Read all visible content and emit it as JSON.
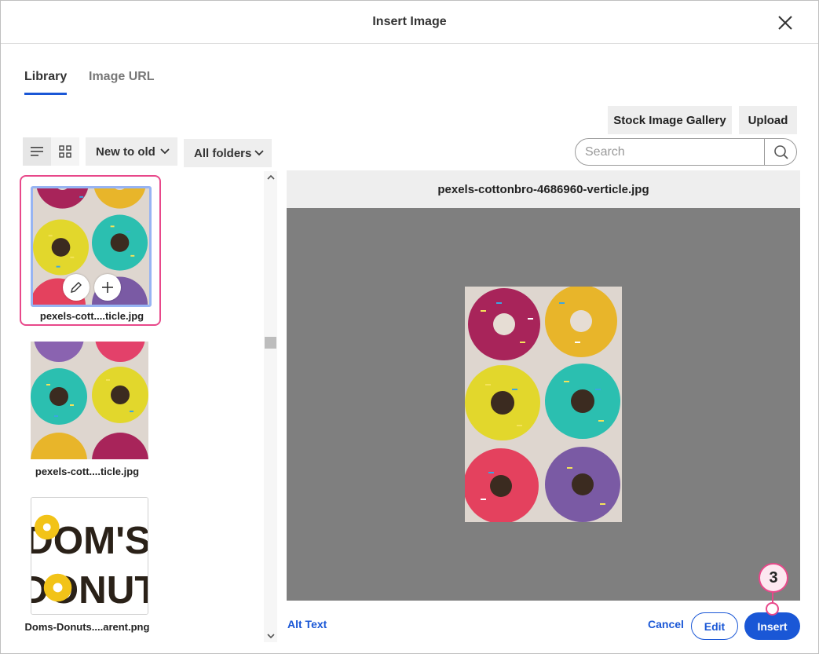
{
  "dialog": {
    "title": "Insert Image"
  },
  "tabs": [
    {
      "label": "Library",
      "active": true
    },
    {
      "label": "Image URL",
      "active": false
    }
  ],
  "actions": {
    "stock_gallery": "Stock Image Gallery",
    "upload": "Upload"
  },
  "toolbar": {
    "view_mode": "list",
    "sort": "New to old",
    "folder": "All folders",
    "search_placeholder": "Search"
  },
  "library": {
    "items": [
      {
        "filename": "pexels-cott....ticle.jpg",
        "selected": true
      },
      {
        "filename": "pexels-cott....ticle.jpg",
        "selected": false
      },
      {
        "filename": "Doms-Donuts....arent.png",
        "selected": false
      }
    ]
  },
  "preview": {
    "filename": "pexels-cottonbro-4686960-verticle.jpg"
  },
  "footer": {
    "alt_text": "Alt Text",
    "cancel": "Cancel",
    "edit": "Edit",
    "insert": "Insert"
  },
  "annotation": {
    "step": "3"
  },
  "logo_text": "DOM'S DONUT",
  "colors": {
    "accent": "#1a57d6",
    "highlight": "#e8488a",
    "selection_border": "#97b4f3",
    "preview_bg": "#7f7f7f"
  }
}
